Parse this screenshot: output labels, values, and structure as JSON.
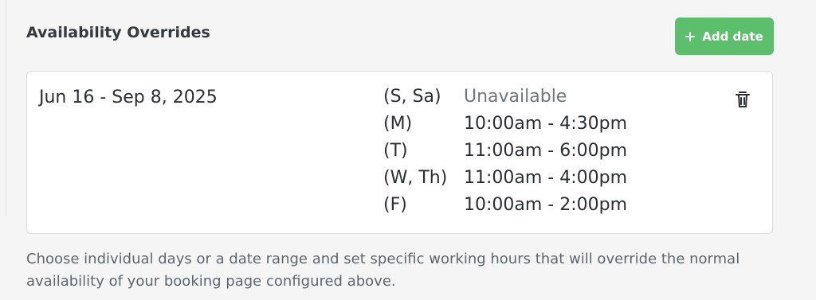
{
  "section": {
    "title": "Availability Overrides",
    "add_button_label": "Add date",
    "plus_icon": "plus-icon",
    "accent_color": "#5cbf6b"
  },
  "override": {
    "date_range": "Jun 16 - Sep 8, 2025",
    "delete_icon": "trash-icon",
    "rows": [
      {
        "days": "(S, Sa)",
        "hours": "Unavailable"
      },
      {
        "days": "(M)",
        "hours": "10:00am - 4:30pm"
      },
      {
        "days": "(T)",
        "hours": "11:00am - 6:00pm"
      },
      {
        "days": "(W, Th)",
        "hours": "11:00am - 4:00pm"
      },
      {
        "days": "(F)",
        "hours": "10:00am - 2:00pm"
      }
    ]
  },
  "help": {
    "text": "Choose individual days or a date range and set specific working hours that will override the normal availability of your booking page configured above."
  }
}
